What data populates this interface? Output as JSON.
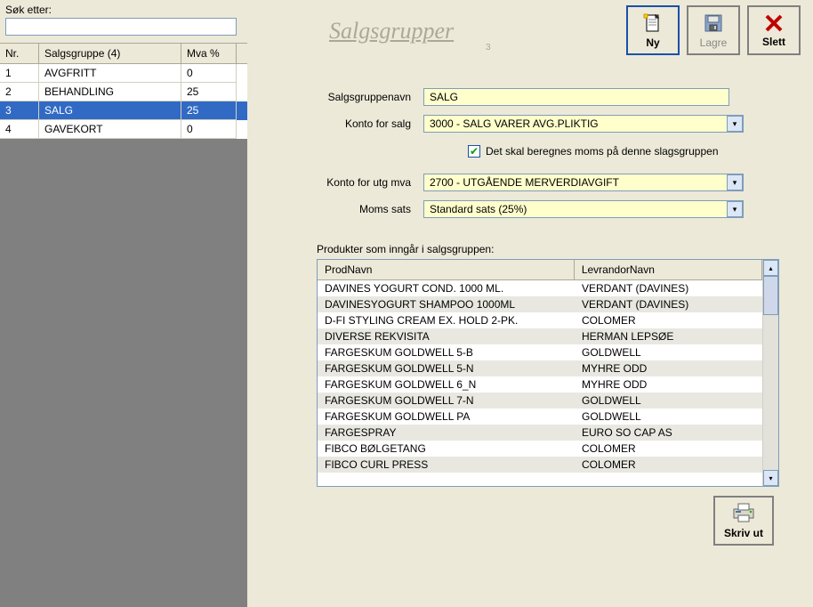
{
  "search": {
    "label": "Søk etter:",
    "value": ""
  },
  "grid": {
    "headers": {
      "nr": "Nr.",
      "name": "Salgsgruppe (4)",
      "mva": "Mva %"
    },
    "rows": [
      {
        "nr": "1",
        "name": "AVGFRITT",
        "mva": "0",
        "selected": false
      },
      {
        "nr": "2",
        "name": "BEHANDLING",
        "mva": "25",
        "selected": false
      },
      {
        "nr": "3",
        "name": "SALG",
        "mva": "25",
        "selected": true
      },
      {
        "nr": "4",
        "name": "GAVEKORT",
        "mva": "0",
        "selected": false
      }
    ]
  },
  "toolbar": {
    "ny": {
      "label": "Ny"
    },
    "lagre": {
      "label": "Lagre"
    },
    "slett": {
      "label": "Slett"
    }
  },
  "title": {
    "text": "Salgsgrupper",
    "badge": "3"
  },
  "form": {
    "labels": {
      "name": "Salgsgruppenavn",
      "konto": "Konto for salg",
      "checkbox": "Det skal beregnes moms på denne slagsgruppen",
      "utgmva": "Konto for utg mva",
      "sats": "Moms sats"
    },
    "values": {
      "name": "SALG",
      "konto": "3000 - SALG VARER AVG.PLIKTIG",
      "checked": true,
      "utgmva": "2700 - UTGÅENDE MERVERDIAVGIFT",
      "sats": "Standard sats (25%)"
    }
  },
  "products": {
    "label": "Produkter som inngår i salgsgruppen:",
    "headers": {
      "name": "ProdNavn",
      "vendor": "LevrandorNavn"
    },
    "rows": [
      {
        "name": "DAVINES YOGURT COND. 1000 ML.",
        "vendor": "VERDANT (DAVINES)"
      },
      {
        "name": "DAVINESYOGURT SHAMPOO 1000ML",
        "vendor": "VERDANT (DAVINES)"
      },
      {
        "name": "D-FI STYLING CREAM EX. HOLD 2-PK.",
        "vendor": "COLOMER"
      },
      {
        "name": "DIVERSE REKVISITA",
        "vendor": "HERMAN LEPSØE"
      },
      {
        "name": "FARGESKUM GOLDWELL 5-B",
        "vendor": "GOLDWELL"
      },
      {
        "name": "FARGESKUM GOLDWELL 5-N",
        "vendor": "MYHRE ODD"
      },
      {
        "name": "FARGESKUM GOLDWELL 6_N",
        "vendor": "MYHRE ODD"
      },
      {
        "name": "FARGESKUM GOLDWELL 7-N",
        "vendor": "GOLDWELL"
      },
      {
        "name": "FARGESKUM GOLDWELL PA",
        "vendor": "GOLDWELL"
      },
      {
        "name": "FARGESPRAY",
        "vendor": "EURO SO CAP AS"
      },
      {
        "name": "FIBCO BØLGETANG",
        "vendor": "COLOMER"
      },
      {
        "name": "FIBCO CURL PRESS",
        "vendor": "COLOMER"
      }
    ]
  },
  "print": {
    "label": "Skriv ut"
  }
}
